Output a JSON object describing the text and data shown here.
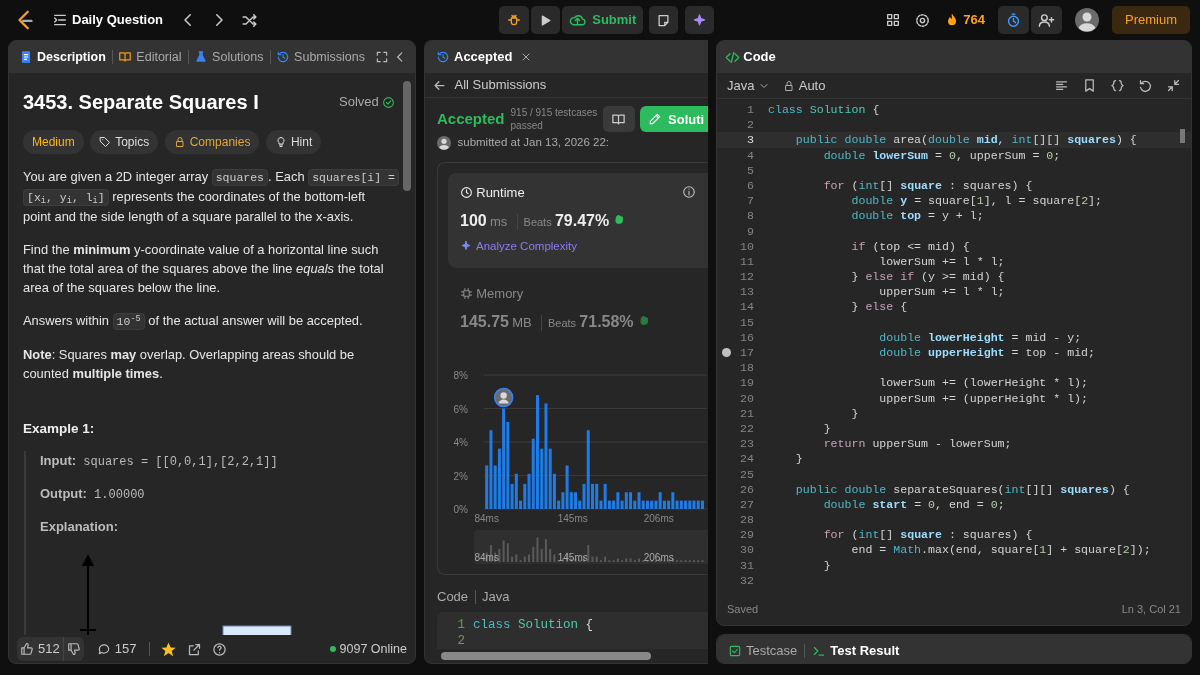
{
  "topbar": {
    "title": "Daily Question",
    "submit": "Submit",
    "streak": "764",
    "premium": "Premium"
  },
  "description": {
    "tabs": [
      {
        "label": "Description",
        "selected": true
      },
      {
        "label": "Editorial",
        "selected": false
      },
      {
        "label": "Solutions",
        "selected": false
      },
      {
        "label": "Submissions",
        "selected": false
      }
    ],
    "title": "3453. Separate Squares I",
    "status": "Solved",
    "tags": [
      {
        "label": "Medium",
        "kind": "difficulty"
      },
      {
        "label": "Topics",
        "kind": "topics"
      },
      {
        "label": "Companies",
        "kind": "companies"
      },
      {
        "label": "Hint",
        "kind": "hint"
      }
    ],
    "paragraphs": [
      [
        {
          "kind": "text",
          "text": "You are given a 2D integer array "
        },
        {
          "kind": "code",
          "text": "squares"
        },
        {
          "kind": "text",
          "text": ". Each "
        },
        {
          "kind": "code",
          "text": "squares[i] = [x$_{i}$, y$_{i}$, l$_{i}$]"
        },
        {
          "kind": "text",
          "text": " represents the coordinates of the bottom-left point and the side length of a square parallel to the x-axis."
        }
      ],
      [
        {
          "kind": "text",
          "text": "Find the **minimum** y-coordinate value of a horizontal line such that the total area of the squares above the line *equals* the total area of the squares below the line."
        }
      ],
      [
        {
          "kind": "text",
          "text": "Answers within "
        },
        {
          "kind": "code",
          "text": "10$^{-5}$"
        },
        {
          "kind": "text",
          "text": " of the actual answer will be accepted."
        }
      ],
      [
        {
          "kind": "text",
          "text": "**Note**: Squares **may** overlap. Overlapping areas should be counted **multiple times**."
        }
      ]
    ],
    "example": {
      "title": "Example 1:",
      "lines": [
        {
          "label": "Input:",
          "value": "squares = [[0,0,1],[2,2,1]]"
        },
        {
          "label": "Output:",
          "value": "1.00000"
        },
        {
          "label": "Explanation:"
        }
      ]
    },
    "footer": {
      "likes": "512",
      "comments": "157",
      "favorited": true,
      "online": "9097 Online"
    }
  },
  "submission": {
    "tab": "Accepted",
    "back": "All Submissions",
    "result": "Accepted",
    "testcases": "915 / 915 testcases passed",
    "submitted": "submitted at Jan 13, 2026 22:",
    "solution_button": "Soluti",
    "stats": [
      {
        "title": "Runtime",
        "value": "100",
        "unit": "ms",
        "beats_label": "Beats",
        "beats": "79.47%",
        "analyze": "Analyze Complexity",
        "selected": true
      },
      {
        "title": "Memory",
        "value": "145.75",
        "unit": "MB",
        "beats_label": "Beats",
        "beats": "71.58%",
        "selected": false
      }
    ],
    "chart_data": {
      "type": "bar",
      "x": [
        84,
        87,
        90,
        93,
        96,
        99,
        102,
        105,
        108,
        111,
        114,
        117,
        120,
        123,
        126,
        129,
        132,
        135,
        138,
        141,
        144,
        147,
        150,
        153,
        156,
        159,
        162,
        165,
        168,
        171,
        174,
        177,
        180,
        183,
        186,
        189,
        192,
        195,
        198,
        201,
        204,
        207,
        210,
        213,
        216,
        219,
        222,
        225,
        228,
        231,
        234,
        237
      ],
      "values": [
        2.6,
        4.7,
        2.6,
        3.6,
        6.0,
        5.2,
        1.5,
        2.1,
        0.5,
        1.5,
        2.1,
        4.2,
        6.8,
        3.6,
        6.3,
        3.6,
        2.1,
        0.5,
        1.0,
        2.6,
        1.0,
        1.0,
        0.5,
        1.5,
        4.7,
        1.5,
        1.5,
        0.5,
        1.5,
        0.5,
        0.5,
        1.0,
        0.5,
        1.0,
        1.0,
        0.5,
        1.0,
        0.5,
        0.5,
        0.5,
        0.5,
        1.0,
        0.5,
        0.5,
        1.0,
        0.5,
        0.5,
        0.5,
        0.5,
        0.5,
        0.5,
        0.5
      ],
      "xlim": [
        82,
        240
      ],
      "ylim": [
        0,
        8
      ],
      "grid": true,
      "yticks": [
        {
          "value": 0,
          "label": "0%"
        },
        {
          "value": 2,
          "label": "2%"
        },
        {
          "value": 4,
          "label": "4%"
        },
        {
          "value": 6,
          "label": "6%"
        },
        {
          "value": 8,
          "label": "8%"
        }
      ],
      "xticks": [
        {
          "value": 84,
          "label": "84ms"
        },
        {
          "value": 145,
          "label": "145ms"
        },
        {
          "value": 206,
          "label": "206ms"
        }
      ]
    },
    "overview_labels": [
      "84ms",
      "145ms",
      "206ms"
    ],
    "code_title": "Code",
    "code_language": "Java",
    "code_preview": [
      {
        "number": "1",
        "segments": [
          {
            "text": "class ",
            "kind": "type"
          },
          {
            "text": "Solution",
            "kind": "cls"
          },
          {
            "text": " {",
            "kind": "plain"
          }
        ]
      },
      {
        "number": "2"
      }
    ]
  },
  "editor": {
    "title": "Code",
    "language": "Java",
    "mode": "Auto",
    "status": "Saved",
    "position": "Ln 3, Col 21",
    "lines": [
      {
        "number": "1",
        "current": false,
        "breakpoint": false,
        "segments": [
          {
            "text": "class ",
            "kind": "type"
          },
          {
            "text": "Solution",
            "kind": "cls"
          },
          {
            "text": " {",
            "kind": "plain"
          }
        ]
      },
      {
        "number": "2",
        "current": false,
        "breakpoint": false
      },
      {
        "number": "3",
        "current": true,
        "breakpoint": false,
        "segments": [
          {
            "text": "    public double ",
            "kind": "type"
          },
          {
            "text": "area(",
            "kind": "plain"
          },
          {
            "text": "double ",
            "kind": "type"
          },
          {
            "text": "mid",
            "kind": "var"
          },
          {
            "text": ", ",
            "kind": "plain"
          },
          {
            "text": "int",
            "kind": "type"
          },
          {
            "text": "[][] ",
            "kind": "plain"
          },
          {
            "text": "squares",
            "kind": "var"
          },
          {
            "text": ") {",
            "kind": "plain"
          }
        ]
      },
      {
        "number": "4",
        "current": false,
        "breakpoint": false,
        "segments": [
          {
            "text": "        double ",
            "kind": "type"
          },
          {
            "text": "lowerSum",
            "kind": "var"
          },
          {
            "text": " = ",
            "kind": "plain"
          },
          {
            "text": "0",
            "kind": "num"
          },
          {
            "text": ", upperSum = ",
            "kind": "plain"
          },
          {
            "text": "0",
            "kind": "num"
          },
          {
            "text": ";",
            "kind": "plain"
          }
        ]
      },
      {
        "number": "5",
        "current": false,
        "breakpoint": false
      },
      {
        "number": "6",
        "current": false,
        "breakpoint": false,
        "segments": [
          {
            "text": "        for ",
            "kind": "ctrl"
          },
          {
            "text": "(",
            "kind": "plain"
          },
          {
            "text": "int",
            "kind": "type"
          },
          {
            "text": "[] ",
            "kind": "plain"
          },
          {
            "text": "square",
            "kind": "var"
          },
          {
            "text": " : squares) {",
            "kind": "plain"
          }
        ]
      },
      {
        "number": "7",
        "current": false,
        "breakpoint": false,
        "segments": [
          {
            "text": "            double ",
            "kind": "type"
          },
          {
            "text": "y",
            "kind": "var"
          },
          {
            "text": " = square[",
            "kind": "plain"
          },
          {
            "text": "1",
            "kind": "num"
          },
          {
            "text": "], l = square[",
            "kind": "plain"
          },
          {
            "text": "2",
            "kind": "num"
          },
          {
            "text": "];",
            "kind": "plain"
          }
        ]
      },
      {
        "number": "8",
        "current": false,
        "breakpoint": false,
        "segments": [
          {
            "text": "            double ",
            "kind": "type"
          },
          {
            "text": "top",
            "kind": "var"
          },
          {
            "text": " = y + l;",
            "kind": "plain"
          }
        ]
      },
      {
        "number": "9",
        "current": false,
        "breakpoint": false
      },
      {
        "number": "10",
        "current": false,
        "breakpoint": false,
        "segments": [
          {
            "text": "            if ",
            "kind": "ctrl"
          },
          {
            "text": "(top <= mid) {",
            "kind": "plain"
          }
        ]
      },
      {
        "number": "11",
        "current": false,
        "breakpoint": false,
        "segments": [
          {
            "text": "                lowerSum += l * l;",
            "kind": "plain"
          }
        ]
      },
      {
        "number": "12",
        "current": false,
        "breakpoint": false,
        "segments": [
          {
            "text": "            } ",
            "kind": "plain"
          },
          {
            "text": "else if ",
            "kind": "ctrl"
          },
          {
            "text": "(y >= mid) {",
            "kind": "plain"
          }
        ]
      },
      {
        "number": "13",
        "current": false,
        "breakpoint": false,
        "segments": [
          {
            "text": "                upperSum += l * l;",
            "kind": "plain"
          }
        ]
      },
      {
        "number": "14",
        "current": false,
        "breakpoint": false,
        "segments": [
          {
            "text": "            } ",
            "kind": "plain"
          },
          {
            "text": "else ",
            "kind": "ctrl"
          },
          {
            "text": "{",
            "kind": "plain"
          }
        ]
      },
      {
        "number": "15",
        "current": false,
        "breakpoint": false
      },
      {
        "number": "16",
        "current": false,
        "breakpoint": false,
        "segments": [
          {
            "text": "                double ",
            "kind": "type"
          },
          {
            "text": "lowerHeight",
            "kind": "var"
          },
          {
            "text": " = mid - y;",
            "kind": "plain"
          }
        ]
      },
      {
        "number": "17",
        "current": false,
        "breakpoint": true,
        "segments": [
          {
            "text": "                double ",
            "kind": "type"
          },
          {
            "text": "upperHeight",
            "kind": "var"
          },
          {
            "text": " = top - mid;",
            "kind": "plain"
          }
        ]
      },
      {
        "number": "18",
        "current": false,
        "breakpoint": false
      },
      {
        "number": "19",
        "current": false,
        "breakpoint": false,
        "segments": [
          {
            "text": "                lowerSum += (lowerHeight * l);",
            "kind": "plain"
          }
        ]
      },
      {
        "number": "20",
        "current": false,
        "breakpoint": false,
        "segments": [
          {
            "text": "                upperSum += (upperHeight * l);",
            "kind": "plain"
          }
        ]
      },
      {
        "number": "21",
        "current": false,
        "breakpoint": false,
        "segments": [
          {
            "text": "            }",
            "kind": "plain"
          }
        ]
      },
      {
        "number": "22",
        "current": false,
        "breakpoint": false,
        "segments": [
          {
            "text": "        }",
            "kind": "plain"
          }
        ]
      },
      {
        "number": "23",
        "current": false,
        "breakpoint": false,
        "segments": [
          {
            "text": "        return ",
            "kind": "ctrl"
          },
          {
            "text": "upperSum - lowerSum;",
            "kind": "plain"
          }
        ]
      },
      {
        "number": "24",
        "current": false,
        "breakpoint": false,
        "segments": [
          {
            "text": "    }",
            "kind": "plain"
          }
        ]
      },
      {
        "number": "25",
        "current": false,
        "breakpoint": false
      },
      {
        "number": "26",
        "current": false,
        "breakpoint": false,
        "segments": [
          {
            "text": "    public double ",
            "kind": "type"
          },
          {
            "text": "separateSquares(",
            "kind": "plain"
          },
          {
            "text": "int",
            "kind": "type"
          },
          {
            "text": "[][] ",
            "kind": "plain"
          },
          {
            "text": "squares",
            "kind": "var"
          },
          {
            "text": ") {",
            "kind": "plain"
          }
        ]
      },
      {
        "number": "27",
        "current": false,
        "breakpoint": false,
        "segments": [
          {
            "text": "        double ",
            "kind": "type"
          },
          {
            "text": "start",
            "kind": "var"
          },
          {
            "text": " = ",
            "kind": "plain"
          },
          {
            "text": "0",
            "kind": "num"
          },
          {
            "text": ", end = ",
            "kind": "plain"
          },
          {
            "text": "0",
            "kind": "num"
          },
          {
            "text": ";",
            "kind": "plain"
          }
        ]
      },
      {
        "number": "28",
        "current": false,
        "breakpoint": false
      },
      {
        "number": "29",
        "current": false,
        "breakpoint": false,
        "segments": [
          {
            "text": "        for ",
            "kind": "ctrl"
          },
          {
            "text": "(",
            "kind": "plain"
          },
          {
            "text": "int",
            "kind": "type"
          },
          {
            "text": "[] ",
            "kind": "plain"
          },
          {
            "text": "square",
            "kind": "var"
          },
          {
            "text": " : squares) {",
            "kind": "plain"
          }
        ]
      },
      {
        "number": "30",
        "current": false,
        "breakpoint": false,
        "segments": [
          {
            "text": "            end = ",
            "kind": "plain"
          },
          {
            "text": "Math",
            "kind": "type"
          },
          {
            "text": ".max(end, square[",
            "kind": "plain"
          },
          {
            "text": "1",
            "kind": "num"
          },
          {
            "text": "] + square[",
            "kind": "plain"
          },
          {
            "text": "2",
            "kind": "num"
          },
          {
            "text": "]);",
            "kind": "plain"
          }
        ]
      },
      {
        "number": "31",
        "current": false,
        "breakpoint": false,
        "segments": [
          {
            "text": "        }",
            "kind": "plain"
          }
        ]
      },
      {
        "number": "32",
        "current": false,
        "breakpoint": false
      }
    ]
  },
  "bottom_tabs": [
    {
      "label": "Testcase",
      "selected": false
    },
    {
      "label": "Test Result",
      "selected": true
    }
  ]
}
